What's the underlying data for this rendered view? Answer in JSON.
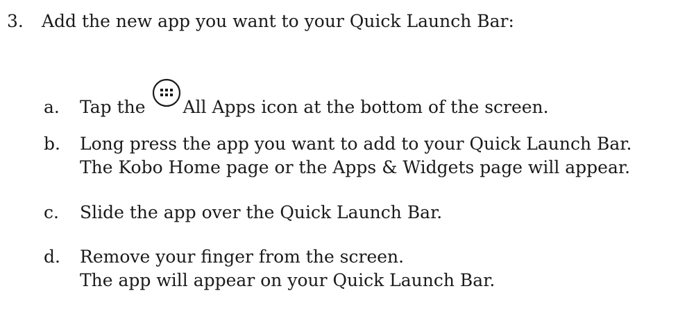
{
  "step": {
    "number": "3.",
    "text": "Add the new app you want to your Quick Launch Bar:"
  },
  "substeps": [
    {
      "letter": "a.",
      "before_icon": "Tap the",
      "icon": "all-apps-icon",
      "after_icon": "All Apps icon at the bottom of the screen."
    },
    {
      "letter": "b.",
      "text": "Long press the app you want to add to your Quick Launch Bar.",
      "text2": "The Kobo Home page or the Apps & Widgets page will appear."
    },
    {
      "letter": "c.",
      "text": "Slide the app over the Quick Launch Bar."
    },
    {
      "letter": "d.",
      "text": "Remove your finger from the screen.",
      "text2": "The app will appear on your Quick Launch Bar."
    }
  ]
}
